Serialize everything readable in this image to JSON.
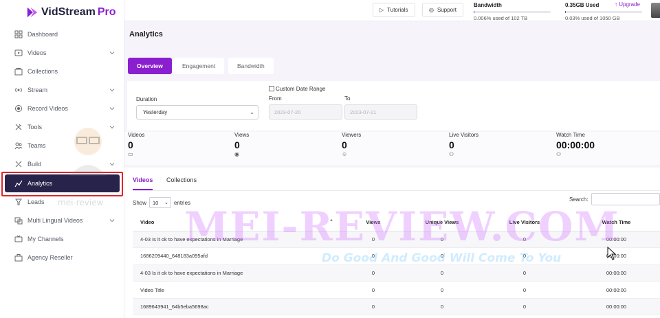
{
  "app": {
    "name": "VidStream",
    "name_suffix": "Pro"
  },
  "sidebar": {
    "items": [
      {
        "label": "Dashboard",
        "icon": "dashboard-icon",
        "chevron": false
      },
      {
        "label": "Videos",
        "icon": "video-icon",
        "chevron": true
      },
      {
        "label": "Collections",
        "icon": "collections-icon",
        "chevron": false
      },
      {
        "label": "Stream",
        "icon": "stream-icon",
        "chevron": true
      },
      {
        "label": "Record Videos",
        "icon": "record-icon",
        "chevron": true
      },
      {
        "label": "Tools",
        "icon": "tools-icon",
        "chevron": true
      },
      {
        "label": "Teams",
        "icon": "teams-icon",
        "chevron": false
      },
      {
        "label": "Build",
        "icon": "build-icon",
        "chevron": true
      },
      {
        "label": "Analytics",
        "icon": "analytics-icon",
        "chevron": false,
        "active": true
      },
      {
        "label": "Leads",
        "icon": "leads-icon",
        "chevron": false
      },
      {
        "label": "Multi Lingual Videos",
        "icon": "language-icon",
        "chevron": true
      },
      {
        "label": "My Channels",
        "icon": "channels-icon",
        "chevron": false
      },
      {
        "label": "Agency Reseller",
        "icon": "agency-icon",
        "chevron": false
      }
    ]
  },
  "topbar": {
    "tutorials_label": "Tutorials",
    "support_label": "Support",
    "bandwidth": {
      "title": "Bandwidth",
      "detail": "0.006% used of 102 TB",
      "fraction": 0.006
    },
    "storage": {
      "title": "0.35GB Used",
      "detail": "0.03% used of 1050 GB",
      "fraction": 0.03
    },
    "upgrade_label": "Upgrade"
  },
  "page": {
    "title": "Analytics"
  },
  "tabs": [
    {
      "label": "Overview",
      "active": true
    },
    {
      "label": "Engagement",
      "active": false
    },
    {
      "label": "Bandwidth",
      "active": false
    }
  ],
  "filters": {
    "duration_label": "Duration",
    "duration_value": "Yesterday",
    "custom_range_label": "Custom Date Range",
    "from_label": "From",
    "to_label": "To",
    "from_value": "2023-07-20",
    "to_value": "2023-07-21"
  },
  "stats": [
    {
      "label": "Videos",
      "value": "0",
      "icon": "video-small-icon"
    },
    {
      "label": "Views",
      "value": "0",
      "icon": "eye-icon"
    },
    {
      "label": "Viewers",
      "value": "0",
      "icon": "viewers-icon"
    },
    {
      "label": "Live Visitors",
      "value": "0",
      "icon": "users-icon"
    },
    {
      "label": "Watch Time",
      "value": "00:00:00",
      "icon": "user-clock-icon"
    }
  ],
  "table_tabs": [
    {
      "label": "Videos",
      "active": true
    },
    {
      "label": "Collections",
      "active": false
    }
  ],
  "table_controls": {
    "show_label": "Show",
    "entries_value": "10",
    "entries_label": "entries",
    "search_label": "Search:"
  },
  "table": {
    "columns": [
      "Video",
      "Views",
      "Unique Views",
      "Live Visitors",
      "Watch Time"
    ],
    "rows": [
      [
        "4-03 Is it ok to have expectations in Marriage",
        "0",
        "0",
        "0",
        "00:00:00"
      ],
      [
        "1686209440_648183a095afd",
        "0",
        "0",
        "0",
        "00:00:00"
      ],
      [
        "4-03 Is it ok to have expectations in Marriage",
        "0",
        "0",
        "0",
        "00:00:00"
      ],
      [
        "Video Title",
        "0",
        "0",
        "0",
        "00:00:00"
      ],
      [
        "1689643941_64b5eba5698ac",
        "0",
        "0",
        "0",
        "00:00:00"
      ]
    ]
  },
  "watermark": {
    "main": "MEI-REVIEW.COM",
    "tagline": "Do Good And Good Will Come To You",
    "small": "mei-review"
  }
}
